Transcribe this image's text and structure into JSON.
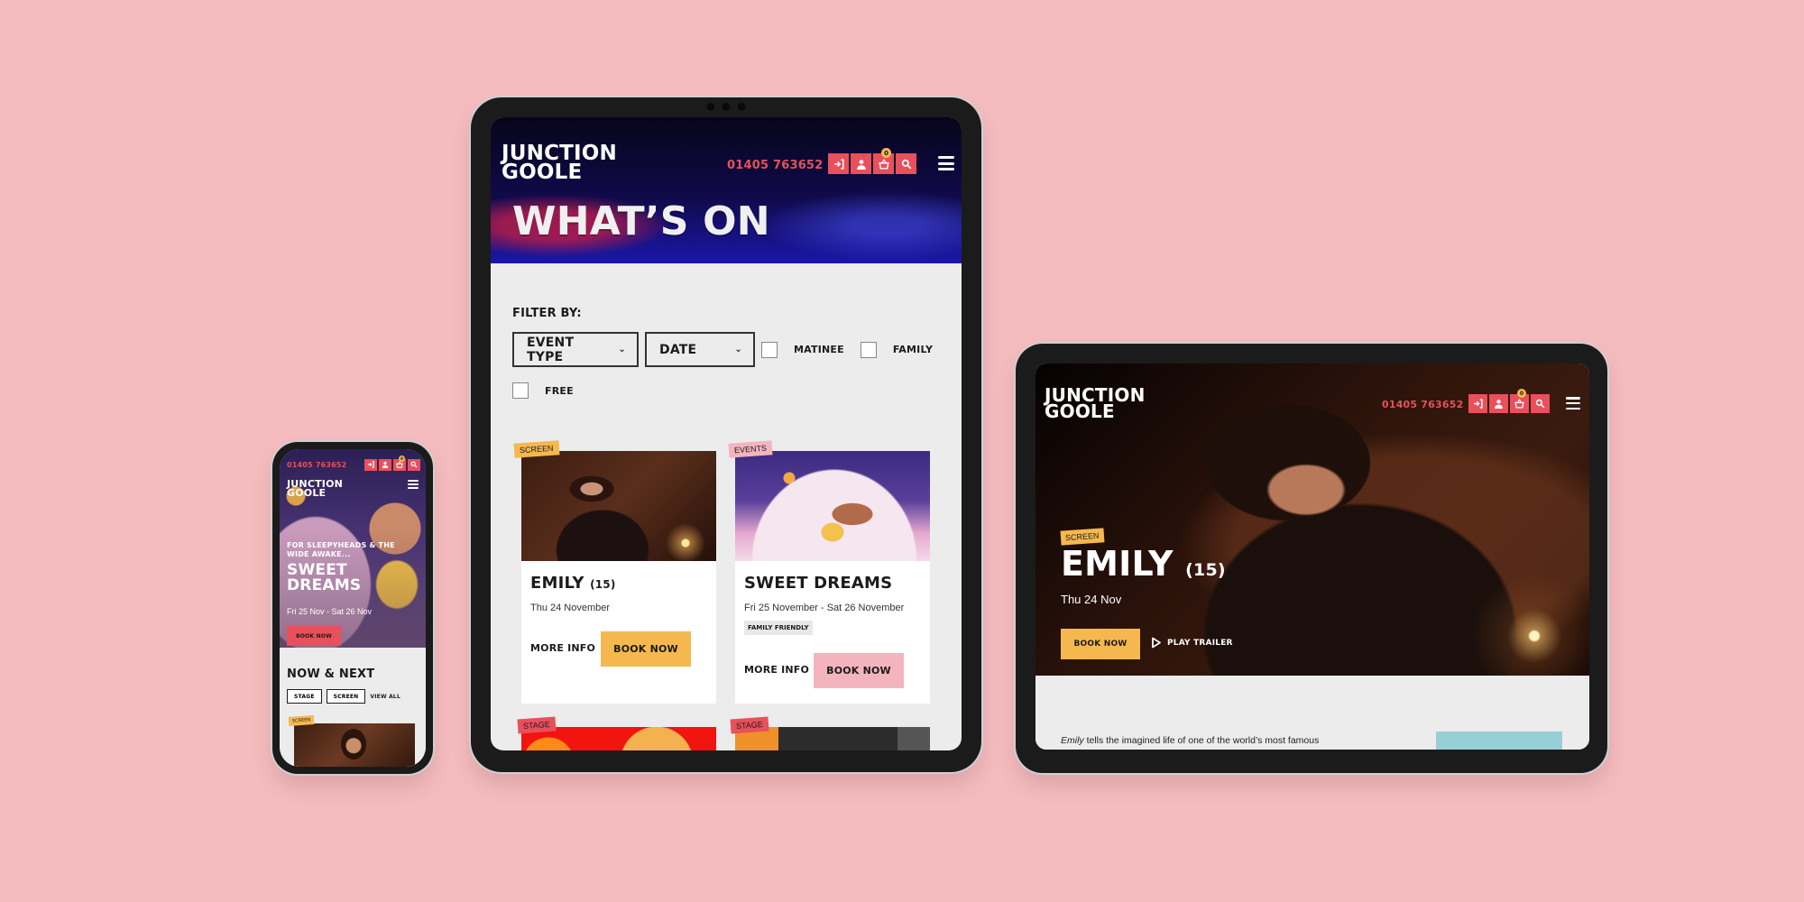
{
  "brand": {
    "logo_line1": "JUNCTION",
    "logo_line2": "GOOLE",
    "phone": "01405 763652",
    "cart_count": "0",
    "colors": {
      "background": "#f4bcbf",
      "accent_red": "#e8505b",
      "accent_yellow": "#f5b84f",
      "accent_pink": "#f4b4be",
      "page_grey": "#ececec",
      "info_teal": "#96d0d6"
    },
    "header_icons": [
      "login-icon",
      "account-icon",
      "basket-icon",
      "search-icon",
      "hamburger-menu-icon"
    ]
  },
  "phone_view": {
    "hero": {
      "kicker": "FOR SLEEPYHEADS & THE WIDE AWAKE...",
      "title_line1": "SWEET",
      "title_line2": "DREAMS",
      "date": "Fri 25 Nov - Sat 26 Nov",
      "book_label": "BOOK NOW"
    },
    "now_next": {
      "heading": "NOW & NEXT",
      "filters": [
        "STAGE",
        "SCREEN"
      ],
      "view_all": "VIEW ALL",
      "first_card_tag": "SCREEN"
    }
  },
  "whats_on_view": {
    "page_title": "WHAT’S ON",
    "filter_label": "FILTER BY:",
    "selects": [
      {
        "label": "EVENT TYPE"
      },
      {
        "label": "DATE"
      }
    ],
    "checkboxes": [
      {
        "label": "MATINEE",
        "checked": false
      },
      {
        "label": "FAMILY",
        "checked": false
      },
      {
        "label": "FREE",
        "checked": false
      }
    ],
    "events": [
      {
        "tag": "SCREEN",
        "title": "EMILY",
        "rating": "(15)",
        "date": "Thu 24 November",
        "badge": "",
        "more_label": "MORE INFO",
        "book_label": "BOOK NOW"
      },
      {
        "tag": "EVENTS",
        "title": "SWEET DREAMS",
        "rating": "",
        "date": "Fri 25 November - Sat 26 November",
        "badge": "FAMILY FRIENDLY",
        "more_label": "MORE INFO",
        "book_label": "BOOK NOW"
      },
      {
        "tag": "STAGE"
      },
      {
        "tag": "STAGE"
      }
    ]
  },
  "event_detail_view": {
    "tag": "SCREEN",
    "title": "EMILY",
    "rating": "(15)",
    "date": "Thu 24 Nov",
    "book_label": "BOOK NOW",
    "trailer_label": "PLAY TRAILER",
    "description_em": "Emily",
    "description": " tells the imagined life of one of the world’s most famous authors, Emily"
  }
}
